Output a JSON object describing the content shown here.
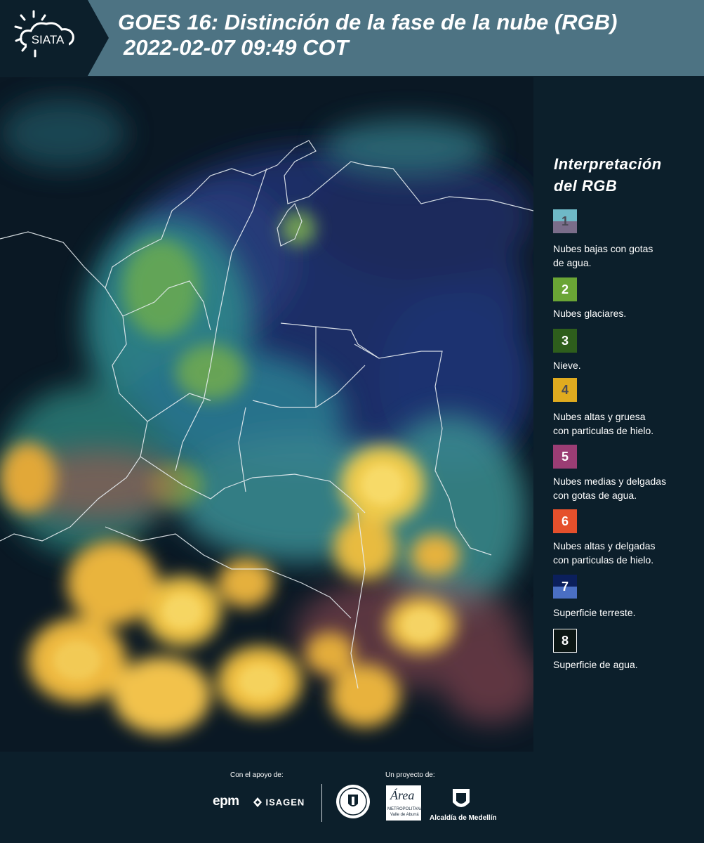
{
  "header": {
    "logo_text": "SIATA",
    "title_line1": "GOES 16: Distinción de la fase de la nube (RGB)",
    "title_line2": "2022-02-07 09:49 COT"
  },
  "legend": {
    "title_line1": "Interpretación",
    "title_line2": "del RGB",
    "items": [
      {
        "num": "1",
        "label_line1": "Nubes bajas con gotas",
        "label_line2": "de agua.",
        "color_top": "#6fb9c7",
        "color_bottom": "#7a6d8a"
      },
      {
        "num": "2",
        "label_line1": "Nubes glaciares.",
        "label_line2": "",
        "color_top": "#6aa535",
        "color_bottom": "#6aa535"
      },
      {
        "num": "3",
        "label_line1": "Nieve.",
        "label_line2": "",
        "color_top": "#2e5e1c",
        "color_bottom": "#2e5e1c"
      },
      {
        "num": "4",
        "label_line1": "Nubes altas y gruesa",
        "label_line2": "con particulas de hielo.",
        "color_top": "#e0ab1f",
        "color_bottom": "#e0ab1f"
      },
      {
        "num": "5",
        "label_line1": "Nubes medias y delgadas",
        "label_line2": "con gotas de agua.",
        "color_top": "#9b3d74",
        "color_bottom": "#9b3d74"
      },
      {
        "num": "6",
        "label_line1": "Nubes altas y delgadas",
        "label_line2": "con particulas de hielo.",
        "color_top": "#e5502c",
        "color_bottom": "#e5502c"
      },
      {
        "num": "7",
        "label_line1": "Superficie terreste.",
        "label_line2": "",
        "color_top": "#0b1f5c",
        "color_bottom": "#4a6fc4"
      },
      {
        "num": "8",
        "label_line1": "Superficie de agua.",
        "label_line2": "",
        "color_top": "#0b1614",
        "color_bottom": "#0b1614"
      }
    ]
  },
  "footer": {
    "support_label": "Con el apoyo de:",
    "project_label": "Un proyecto de:",
    "sponsor1": "epm",
    "sponsor2": "ISAGEN",
    "partner2_big": "Área",
    "partner2_small1": "METROPOLITANA",
    "partner2_small2": "Valle de Aburrá",
    "partner3": "Alcaldía de Medellín"
  }
}
